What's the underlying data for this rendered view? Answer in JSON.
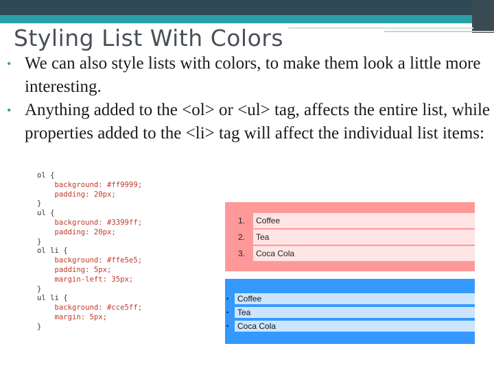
{
  "slide": {
    "title": "Styling List With Colors",
    "bullets": [
      "We can also style lists with colors, to make them look a little more interesting.",
      "Anything added to the <ol> or <ul> tag, affects the entire list, while properties added to the <li> tag will affect the individual list items:"
    ],
    "bullet_color": "#2aa0a8"
  },
  "code_lines": [
    "ol {",
    "    background: #ff9999;",
    "    padding: 20px;",
    "}",
    "",
    "ul {",
    "    background: #3399ff;",
    "    padding: 20px;",
    "}",
    "",
    "ol li {",
    "    background: #ffe5e5;",
    "    padding: 5px;",
    "    margin-left: 35px;",
    "}",
    "",
    "ul li {",
    "    background: #cce5ff;",
    "    margin: 5px;",
    "}"
  ],
  "example_ol": {
    "background": "#ff9999",
    "item_background": "#ffe5e5",
    "items": [
      {
        "marker": "1.",
        "label": "Coffee"
      },
      {
        "marker": "2.",
        "label": "Tea"
      },
      {
        "marker": "3.",
        "label": "Coca Cola"
      }
    ]
  },
  "example_ul": {
    "background": "#3399ff",
    "item_background": "#cce5ff",
    "items": [
      {
        "marker": "•",
        "label": "Coffee"
      },
      {
        "marker": "•",
        "label": "Tea"
      },
      {
        "marker": "•",
        "label": "Coca Cola"
      }
    ]
  }
}
